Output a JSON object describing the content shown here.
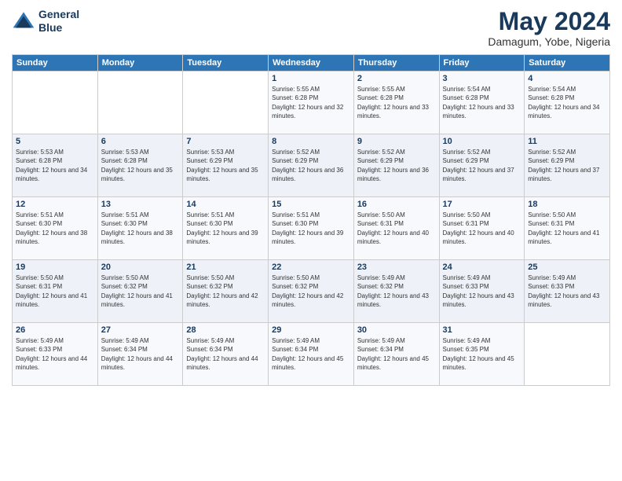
{
  "logo": {
    "line1": "General",
    "line2": "Blue"
  },
  "title": "May 2024",
  "location": "Damagum, Yobe, Nigeria",
  "days_of_week": [
    "Sunday",
    "Monday",
    "Tuesday",
    "Wednesday",
    "Thursday",
    "Friday",
    "Saturday"
  ],
  "weeks": [
    [
      {
        "day": "",
        "sunrise": "",
        "sunset": "",
        "daylight": ""
      },
      {
        "day": "",
        "sunrise": "",
        "sunset": "",
        "daylight": ""
      },
      {
        "day": "",
        "sunrise": "",
        "sunset": "",
        "daylight": ""
      },
      {
        "day": "1",
        "sunrise": "Sunrise: 5:55 AM",
        "sunset": "Sunset: 6:28 PM",
        "daylight": "Daylight: 12 hours and 32 minutes."
      },
      {
        "day": "2",
        "sunrise": "Sunrise: 5:55 AM",
        "sunset": "Sunset: 6:28 PM",
        "daylight": "Daylight: 12 hours and 33 minutes."
      },
      {
        "day": "3",
        "sunrise": "Sunrise: 5:54 AM",
        "sunset": "Sunset: 6:28 PM",
        "daylight": "Daylight: 12 hours and 33 minutes."
      },
      {
        "day": "4",
        "sunrise": "Sunrise: 5:54 AM",
        "sunset": "Sunset: 6:28 PM",
        "daylight": "Daylight: 12 hours and 34 minutes."
      }
    ],
    [
      {
        "day": "5",
        "sunrise": "Sunrise: 5:53 AM",
        "sunset": "Sunset: 6:28 PM",
        "daylight": "Daylight: 12 hours and 34 minutes."
      },
      {
        "day": "6",
        "sunrise": "Sunrise: 5:53 AM",
        "sunset": "Sunset: 6:28 PM",
        "daylight": "Daylight: 12 hours and 35 minutes."
      },
      {
        "day": "7",
        "sunrise": "Sunrise: 5:53 AM",
        "sunset": "Sunset: 6:29 PM",
        "daylight": "Daylight: 12 hours and 35 minutes."
      },
      {
        "day": "8",
        "sunrise": "Sunrise: 5:52 AM",
        "sunset": "Sunset: 6:29 PM",
        "daylight": "Daylight: 12 hours and 36 minutes."
      },
      {
        "day": "9",
        "sunrise": "Sunrise: 5:52 AM",
        "sunset": "Sunset: 6:29 PM",
        "daylight": "Daylight: 12 hours and 36 minutes."
      },
      {
        "day": "10",
        "sunrise": "Sunrise: 5:52 AM",
        "sunset": "Sunset: 6:29 PM",
        "daylight": "Daylight: 12 hours and 37 minutes."
      },
      {
        "day": "11",
        "sunrise": "Sunrise: 5:52 AM",
        "sunset": "Sunset: 6:29 PM",
        "daylight": "Daylight: 12 hours and 37 minutes."
      }
    ],
    [
      {
        "day": "12",
        "sunrise": "Sunrise: 5:51 AM",
        "sunset": "Sunset: 6:30 PM",
        "daylight": "Daylight: 12 hours and 38 minutes."
      },
      {
        "day": "13",
        "sunrise": "Sunrise: 5:51 AM",
        "sunset": "Sunset: 6:30 PM",
        "daylight": "Daylight: 12 hours and 38 minutes."
      },
      {
        "day": "14",
        "sunrise": "Sunrise: 5:51 AM",
        "sunset": "Sunset: 6:30 PM",
        "daylight": "Daylight: 12 hours and 39 minutes."
      },
      {
        "day": "15",
        "sunrise": "Sunrise: 5:51 AM",
        "sunset": "Sunset: 6:30 PM",
        "daylight": "Daylight: 12 hours and 39 minutes."
      },
      {
        "day": "16",
        "sunrise": "Sunrise: 5:50 AM",
        "sunset": "Sunset: 6:31 PM",
        "daylight": "Daylight: 12 hours and 40 minutes."
      },
      {
        "day": "17",
        "sunrise": "Sunrise: 5:50 AM",
        "sunset": "Sunset: 6:31 PM",
        "daylight": "Daylight: 12 hours and 40 minutes."
      },
      {
        "day": "18",
        "sunrise": "Sunrise: 5:50 AM",
        "sunset": "Sunset: 6:31 PM",
        "daylight": "Daylight: 12 hours and 41 minutes."
      }
    ],
    [
      {
        "day": "19",
        "sunrise": "Sunrise: 5:50 AM",
        "sunset": "Sunset: 6:31 PM",
        "daylight": "Daylight: 12 hours and 41 minutes."
      },
      {
        "day": "20",
        "sunrise": "Sunrise: 5:50 AM",
        "sunset": "Sunset: 6:32 PM",
        "daylight": "Daylight: 12 hours and 41 minutes."
      },
      {
        "day": "21",
        "sunrise": "Sunrise: 5:50 AM",
        "sunset": "Sunset: 6:32 PM",
        "daylight": "Daylight: 12 hours and 42 minutes."
      },
      {
        "day": "22",
        "sunrise": "Sunrise: 5:50 AM",
        "sunset": "Sunset: 6:32 PM",
        "daylight": "Daylight: 12 hours and 42 minutes."
      },
      {
        "day": "23",
        "sunrise": "Sunrise: 5:49 AM",
        "sunset": "Sunset: 6:32 PM",
        "daylight": "Daylight: 12 hours and 43 minutes."
      },
      {
        "day": "24",
        "sunrise": "Sunrise: 5:49 AM",
        "sunset": "Sunset: 6:33 PM",
        "daylight": "Daylight: 12 hours and 43 minutes."
      },
      {
        "day": "25",
        "sunrise": "Sunrise: 5:49 AM",
        "sunset": "Sunset: 6:33 PM",
        "daylight": "Daylight: 12 hours and 43 minutes."
      }
    ],
    [
      {
        "day": "26",
        "sunrise": "Sunrise: 5:49 AM",
        "sunset": "Sunset: 6:33 PM",
        "daylight": "Daylight: 12 hours and 44 minutes."
      },
      {
        "day": "27",
        "sunrise": "Sunrise: 5:49 AM",
        "sunset": "Sunset: 6:34 PM",
        "daylight": "Daylight: 12 hours and 44 minutes."
      },
      {
        "day": "28",
        "sunrise": "Sunrise: 5:49 AM",
        "sunset": "Sunset: 6:34 PM",
        "daylight": "Daylight: 12 hours and 44 minutes."
      },
      {
        "day": "29",
        "sunrise": "Sunrise: 5:49 AM",
        "sunset": "Sunset: 6:34 PM",
        "daylight": "Daylight: 12 hours and 45 minutes."
      },
      {
        "day": "30",
        "sunrise": "Sunrise: 5:49 AM",
        "sunset": "Sunset: 6:34 PM",
        "daylight": "Daylight: 12 hours and 45 minutes."
      },
      {
        "day": "31",
        "sunrise": "Sunrise: 5:49 AM",
        "sunset": "Sunset: 6:35 PM",
        "daylight": "Daylight: 12 hours and 45 minutes."
      },
      {
        "day": "",
        "sunrise": "",
        "sunset": "",
        "daylight": ""
      }
    ]
  ]
}
